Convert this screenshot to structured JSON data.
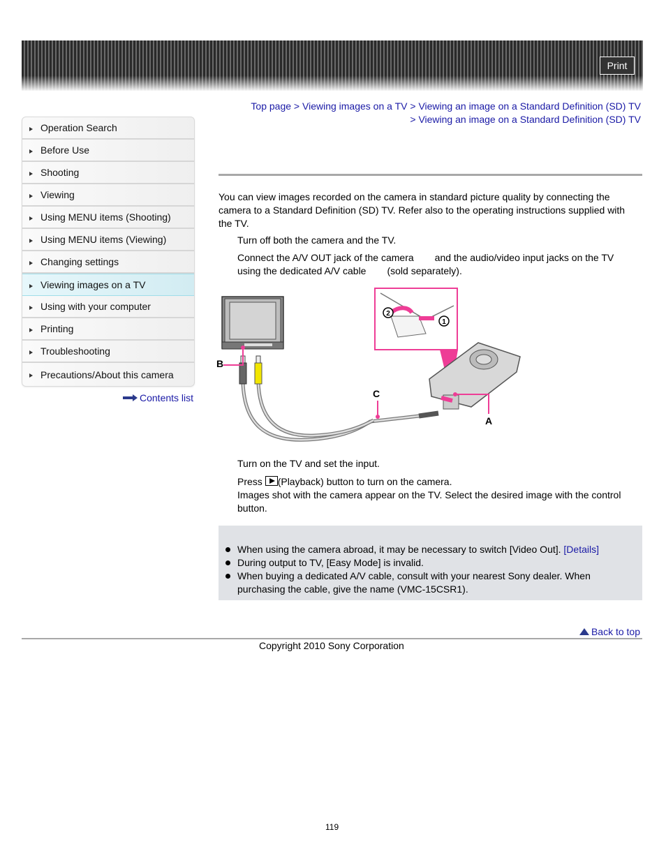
{
  "header": {
    "print_label": "Print"
  },
  "sidebar": {
    "items": [
      {
        "label": "Operation Search",
        "active": false
      },
      {
        "label": "Before Use",
        "active": false
      },
      {
        "label": "Shooting",
        "active": false
      },
      {
        "label": "Viewing",
        "active": false
      },
      {
        "label": "Using MENU items (Shooting)",
        "active": false
      },
      {
        "label": "Using MENU items (Viewing)",
        "active": false
      },
      {
        "label": "Changing settings",
        "active": false
      },
      {
        "label": "Viewing images on a TV",
        "active": true
      },
      {
        "label": "Using with your computer",
        "active": false
      },
      {
        "label": "Printing",
        "active": false
      },
      {
        "label": "Troubleshooting",
        "active": false
      },
      {
        "label": "Precautions/About this camera",
        "active": false
      }
    ],
    "contents_link": "Contents list"
  },
  "breadcrumb": {
    "items": [
      "Top page",
      "Viewing images on a TV",
      "Viewing an image on a Standard Definition (SD) TV",
      "Viewing an image on a Standard Definition (SD) TV"
    ],
    "separator": ">"
  },
  "main": {
    "intro": "You can view images recorded on the camera in standard picture quality by connecting the camera to a Standard Definition (SD) TV. Refer also to the operating instructions supplied with the TV.",
    "steps": [
      {
        "text": "Turn off both the camera and the TV."
      },
      {
        "text_a": "Connect the A/V OUT jack of the camera",
        "text_b": "and the audio/video input jacks on the TV using the dedicated A/V cable",
        "text_c": "(sold separately)."
      },
      {
        "text": "Turn on the TV and set the input."
      },
      {
        "text_a": "Press",
        "text_b": "(Playback) button to turn on the camera.",
        "text_c": "Images shot with the camera appear on the TV. Select the desired image with the control button."
      }
    ],
    "diagram": {
      "labels": {
        "a": "A",
        "b": "B",
        "c": "C",
        "step1": "1",
        "step2": "2"
      },
      "accent_color": "#ee3d96",
      "plug_yellow": "#f2e600"
    }
  },
  "notes": {
    "items": [
      {
        "text": "When using the camera abroad, it may be necessary to switch [Video Out].",
        "link": "[Details]"
      },
      {
        "text": "During output to TV, [Easy Mode] is invalid."
      },
      {
        "text": "When buying a dedicated A/V cable, consult with your nearest Sony dealer. When purchasing the cable, give the name (VMC-15CSR1)."
      }
    ]
  },
  "footer": {
    "back_to_top": "Back to top",
    "copyright": "Copyright 2010 Sony Corporation",
    "page_number": "119"
  },
  "colors": {
    "link": "#1a1aa6",
    "active_nav": "#d9f0f5",
    "notes_bg": "#e0e2e6"
  }
}
